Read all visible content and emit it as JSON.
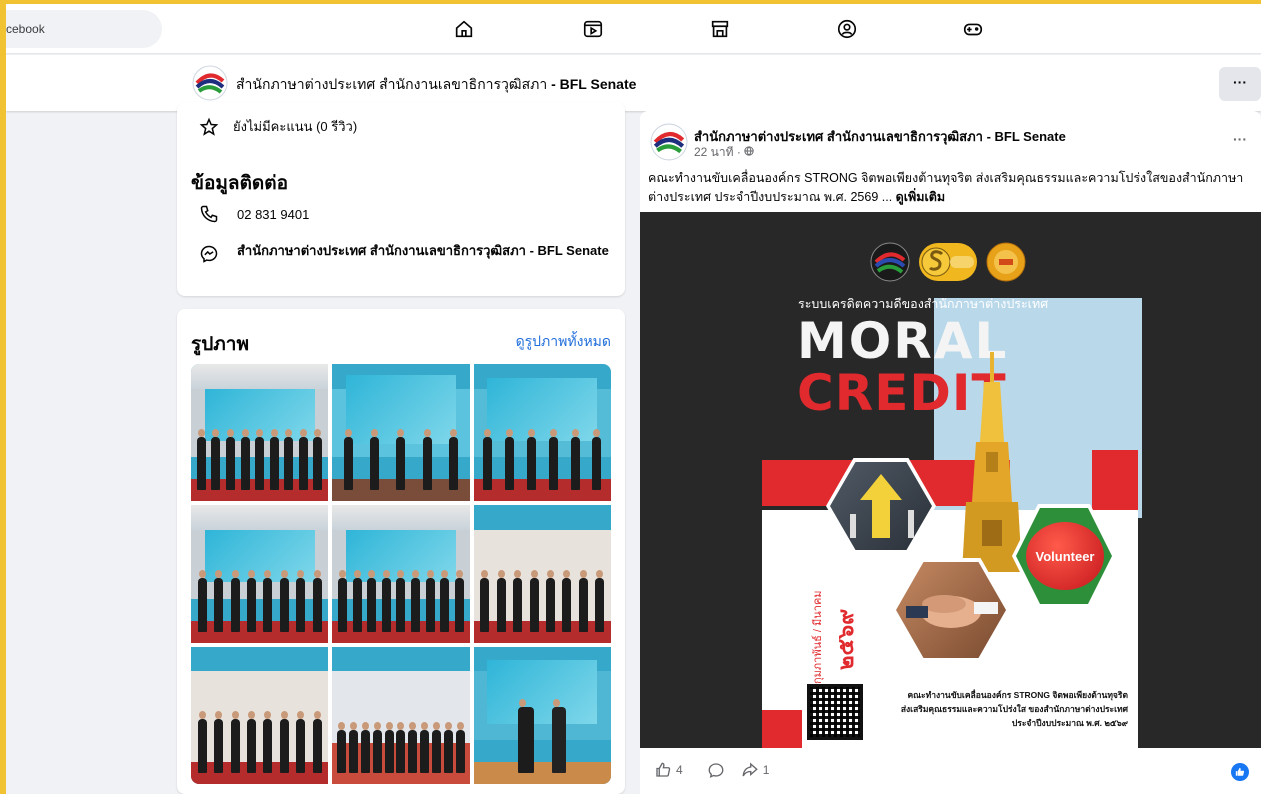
{
  "search": {
    "text": "cebook"
  },
  "nav": {
    "icons": [
      "home-icon",
      "video-icon",
      "marketplace-icon",
      "groups-icon",
      "gaming-icon"
    ]
  },
  "page": {
    "name_thai": "สำนักภาษาต่างประเทศ สำนักงานเลขาธิการวุฒิสภา",
    "name_en": " - BFL Senate",
    "more": "···"
  },
  "contact_card": {
    "rating": "ยังไม่มีคะแนน (0 รีวิว)",
    "section_title": "ข้อมูลติดต่อ",
    "phone": "02 831 9401",
    "messenger": "สำนักภาษาต่างประเทศ สำนักงานเลขาธิการวุฒิสภา - BFL Senate"
  },
  "photos_card": {
    "title": "รูปภาพ",
    "see_all": "ดูรูปภาพทั้งหมด"
  },
  "post": {
    "author": "สำนักภาษาต่างประเทศ สำนักงานเลขาธิการวุฒิสภา - BFL Senate",
    "time": "22 นาที · ",
    "text": "คณะทำงานขับเคลื่อนองค์กร STRONG จิตพอเพียงต้านทุจริต ส่งเสริมคุณธรรมและความโปร่งใสของสำนักภาษาต่างประเทศ ประจำปีงบประมาณ พ.ศ. 2569 ... ",
    "see_more": "ดูเพิ่มเติม",
    "more": "···",
    "poster": {
      "subtitle": "ระบบเครดิตความดีของสำนักภาษาต่างประเทศ",
      "title_line1": "MORAL",
      "title_line2": "CREDIT",
      "volunteer": "Volunteer",
      "vertical_year": "๒๕๖๙",
      "vertical_months": "กุมภาพันธ์ / มีนาคม",
      "footer_line1": "คณะทำงานขับเคลื่อนองค์กร STRONG จิตพอเพียงต้านทุจริต",
      "footer_line2": "ส่งเสริมคุณธรรมและความโปร่งใส ของสำนักภาษาต่างประเทศ",
      "footer_line3": "ประจำปีงบประมาณ พ.ศ. ๒๕๖๙"
    },
    "likes": "4",
    "shares": "1"
  },
  "colors": {
    "border": "#f1c232",
    "link": "#216fdb",
    "accent_red": "#e02a2e",
    "like_blue": "#1877f2"
  }
}
